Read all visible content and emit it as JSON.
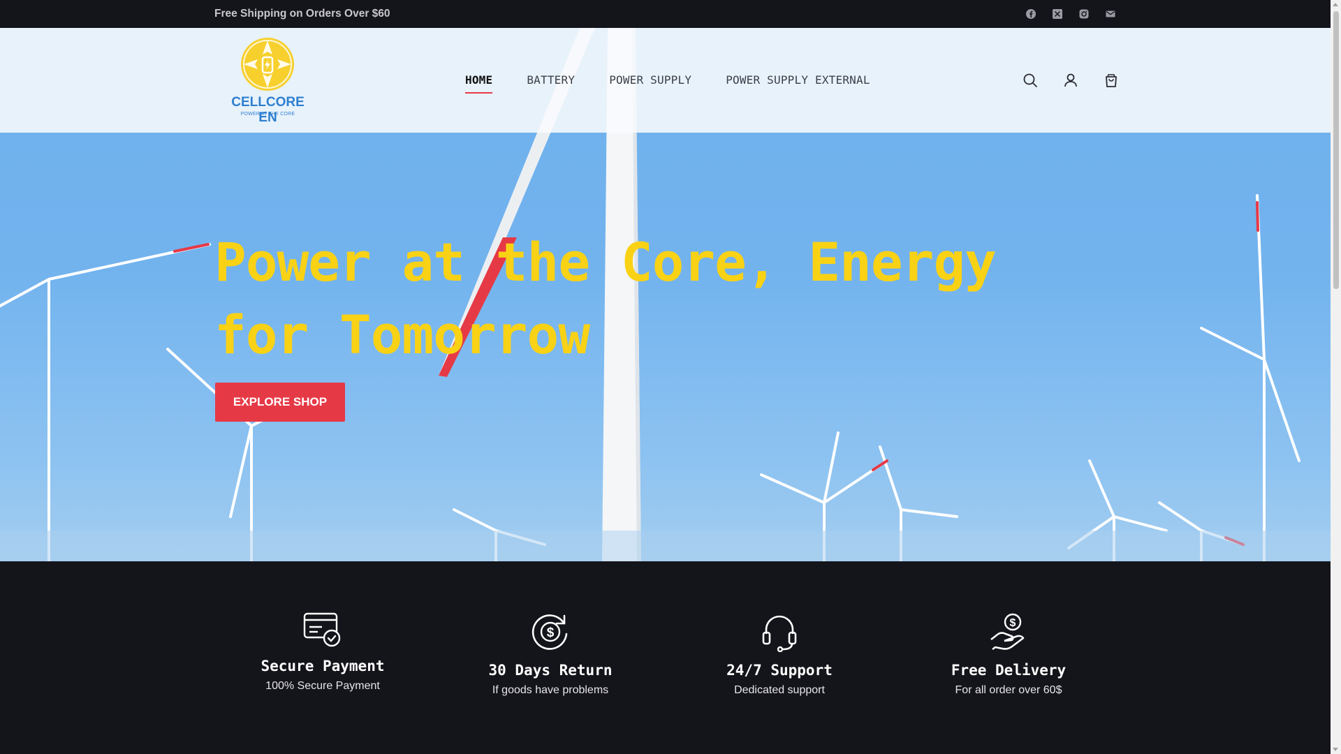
{
  "topbar": {
    "promo": "Free Shipping on Orders Over $60",
    "socials": [
      "facebook-icon",
      "x-twitter-icon",
      "instagram-icon",
      "email-icon"
    ]
  },
  "header": {
    "logo": {
      "brand": "CELLCORE EN",
      "tagline": "POWER AT THE CORE"
    },
    "nav": [
      {
        "label": "HOME",
        "active": true
      },
      {
        "label": "BATTERY",
        "active": false
      },
      {
        "label": "POWER SUPPLY",
        "active": false
      },
      {
        "label": "POWER SUPPLY EXTERNAL",
        "active": false
      }
    ],
    "icons": [
      "search-icon",
      "account-icon",
      "cart-icon"
    ]
  },
  "hero": {
    "headline_line1": "Power at the Core, Energy",
    "headline_line2": "for Tomorrow",
    "cta_label": "EXPLORE SHOP"
  },
  "features": [
    {
      "icon": "card-check-icon",
      "title": "Secure Payment",
      "subtitle": "100% Secure Payment"
    },
    {
      "icon": "money-return-icon",
      "title": "30 Days Return",
      "subtitle": "If goods have problems"
    },
    {
      "icon": "headset-icon",
      "title": "24/7 Support",
      "subtitle": "Dedicated support"
    },
    {
      "icon": "hand-money-icon",
      "title": "Free Delivery",
      "subtitle": "For all order over 60$"
    }
  ],
  "colors": {
    "accent": "#e63946",
    "headline": "#f9d215",
    "dark": "#14141b",
    "brand_blue": "#2d7fcf",
    "logo_yellow": "#f7d02e"
  }
}
